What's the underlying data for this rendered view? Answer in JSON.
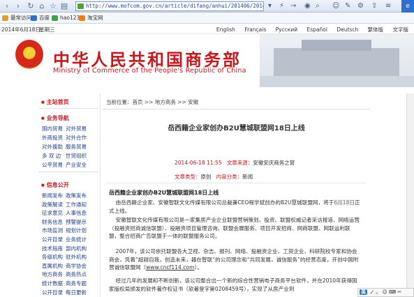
{
  "browser": {
    "address": "http://www.mofcom.gov.cn/article/difang/anhui/201406/2014",
    "favorites": [
      {
        "label": "最常访问",
        "color": "#e99a24"
      },
      {
        "label": "百度",
        "color": "#2f6fd1"
      },
      {
        "label": "hao123",
        "color": "#3da44b"
      },
      {
        "label": "淘宝网",
        "color": "#ff7a00"
      }
    ]
  },
  "site": {
    "date": "2014年6月18日",
    "weekday": "星期三",
    "languages": [
      "English",
      "Français",
      "Русский",
      "Español",
      "Deutsch",
      "繁体版",
      "文字版"
    ],
    "name_cn": "中华人民共和国商务部",
    "name_en": "Ministry of Commerce of the People's Republic of China",
    "emblem_colors": {
      "red": "#d8281c",
      "gold": "#f5cf38"
    }
  },
  "leftnav": {
    "home": "主站首页",
    "business": {
      "title": "业务导航",
      "rows": [
        [
          "国内贸易",
          "对外贸易"
        ],
        [
          "外商投资",
          "对外合作"
        ],
        [
          "对外援助",
          "服务贸易"
        ],
        [
          "多 双 边",
          "世贸组织"
        ],
        [
          "公平贸易",
          "产业安全"
        ]
      ]
    },
    "info": {
      "title": "信息公开",
      "rows": [
        [
          "新闻发布",
          "政策发布"
        ],
        [
          "政策解读",
          "工作通知"
        ],
        [
          "征求意见",
          "人事信息"
        ],
        [
          "财务信息",
          "预警提示"
        ],
        [
          "市场监测",
          "规划计划"
        ],
        [
          "公开目录",
          "业务统计"
        ],
        [
          "技术指南",
          "部内机构"
        ],
        [
          "各级机构",
          "驻外机构"
        ],
        [
          "直属机构",
          "商学协会"
        ],
        [
          "地方商务",
          "商务热点"
        ],
        [
          "统计数据",
          "商务专题"
        ],
        [
          "公开目录",
          "每日更新"
        ]
      ]
    }
  },
  "article": {
    "breadcrumb": "当前位置：首页 >> 地方商务 >> 安徽",
    "title": "岳西籍企业家创办B2U慧城联盟网18日上线",
    "datetime": "2014-06-18 11:55",
    "source_label": "文章来源：",
    "source_value": "安徽安庆商务之窗",
    "type_label": "文章类型：",
    "type_value": "原创",
    "category_label": "内容分类：",
    "category_value": "新闻",
    "subtitle": "岳西籍企业家创办B2U慧城联盟网18日上线",
    "p1_a": "由岳西籍企业家、安徽智联文化传媒有限公司总裁兼CEO程学斌创办的B2U慧城联盟网，将于",
    "p1_hl": "6月18日",
    "p1_b": "正式上线。",
    "p2": "安徽智联文化传媒有限公司是一家集房产业企业联盟营销策划、投资、联盟权威记者采访报道、网络运营（投融资招商诚信联盟）、投融资项目管理咨询、联盟会展服务、项目开发招商、网商联盟、网联运利联盟，整合招商广告联盟于一体的联盟服务公司。",
    "p3": "2007年，该公司依托联盟各大卫视、杂志、报刊、网络、投融资企业、工贸企业、科研院校专家和协会商会，凭着“超越自我，创造未来，器在智联”的公司理念和“共同发展，诚信服务”的经营态度，开创中国附营诚信联盟网（",
    "p3_link": "www.cncf114.com",
    "p3_end": "）。",
    "p4": "经过几年的发展和不断创新，该公司整合出一个新的综合性营销电子商务平台软件，并在2010年获得国家版权局颁发的软件著作权证书（软著登字第0208459号），实现了从房产业到"
  },
  "ime": {
    "mode": "英",
    "items": "ノ 。 ☺ ⌨ ✂"
  }
}
